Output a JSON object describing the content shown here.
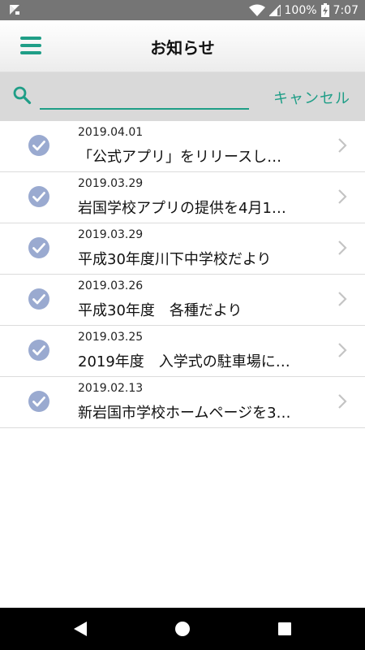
{
  "status_bar": {
    "battery": "100%",
    "time": "7:07",
    "icons": [
      "app-notification-icon",
      "wifi-icon",
      "cell-signal-icon",
      "battery-charging-icon"
    ]
  },
  "header": {
    "title": "お知らせ",
    "menu_icon": "hamburger-menu-icon"
  },
  "search": {
    "value": "",
    "placeholder": "",
    "cancel_label": "キャンセル",
    "icon": "search-icon"
  },
  "colors": {
    "accent": "#1f9e87",
    "check": "#9aaad0",
    "status_bar": "#757575",
    "search_bg": "#d9d9d9"
  },
  "news": [
    {
      "date": "2019.04.01",
      "title": "「公式アプリ」をリリースし…"
    },
    {
      "date": "2019.03.29",
      "title": "岩国学校アプリの提供を4月1…"
    },
    {
      "date": "2019.03.29",
      "title": "平成30年度川下中学校だより"
    },
    {
      "date": "2019.03.26",
      "title": "平成30年度　各種だより"
    },
    {
      "date": "2019.03.25",
      "title": "2019年度　入学式の駐車場に…"
    },
    {
      "date": "2019.02.13",
      "title": "新岩国市学校ホームページを3…"
    }
  ]
}
